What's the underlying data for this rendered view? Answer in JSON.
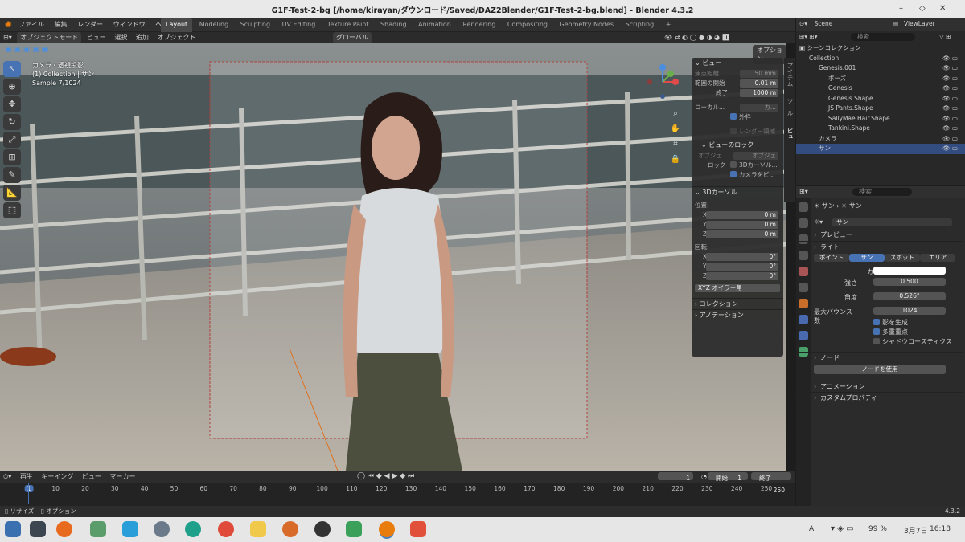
{
  "window": {
    "title": "G1F-Test-2-bg [/home/kirayan/ダウンロード/Saved/DAZ2Blender/G1F-Test-2-bg.blend] - Blender 4.3.2"
  },
  "menu": [
    "ファイル",
    "編集",
    "レンダー",
    "ウィンドウ",
    "ヘルプ"
  ],
  "workspaces": [
    "Layout",
    "Modeling",
    "Sculpting",
    "UV Editing",
    "Texture Paint",
    "Shading",
    "Animation",
    "Rendering",
    "Compositing",
    "Geometry Nodes",
    "Scripting"
  ],
  "scene": {
    "name": "Scene",
    "view_layer": "ViewLayer"
  },
  "viewport_header": {
    "mode": "オブジェクトモード",
    "items": [
      "ビュー",
      "選択",
      "追加",
      "オブジェクト"
    ],
    "orientation": "グローバル",
    "options": "オプション"
  },
  "viewport_info": [
    "カメラ・透視投影",
    "(1) Collection | サン",
    "Sample 7/1024"
  ],
  "npanel": {
    "view_title": "ビュー",
    "focal_label": "焦点距離",
    "focal_value": "50 mm",
    "clip_start_label": "範囲の開始",
    "clip_start_value": "0.01 m",
    "clip_end_label": "終了",
    "clip_end_value": "1000 m",
    "local_label": "ローカル...",
    "local_value": "カ...",
    "outline_label": "外枠",
    "render_region_label": "レンダー領域",
    "lock_title": "ビューのロック",
    "lock_object_label": "オブジェ...",
    "lock_object_value": "オブジェ",
    "lock_label": "ロック",
    "lock_cursor_label": "3Dカーソル...",
    "lock_camera_label": "カメラをビ...",
    "cursor_title": "3Dカーソル",
    "location_label": "位置:",
    "x": "0 m",
    "y": "0 m",
    "z": "0 m",
    "rotation_label": "回転:",
    "rx": "0°",
    "ry": "0°",
    "rz": "0°",
    "rotation_mode": "XYZ オイラー角",
    "collection_title": "コレクション",
    "annotation_title": "アノテーション"
  },
  "side_tabs": [
    "アイテム",
    "ツール",
    "ビュー"
  ],
  "outliner": {
    "search_placeholder": "検索",
    "root": "シーンコレクション",
    "items": [
      {
        "name": "Collection",
        "indent": 1
      },
      {
        "name": "Genesis.001",
        "indent": 2
      },
      {
        "name": "ポーズ",
        "indent": 3
      },
      {
        "name": "Genesis",
        "indent": 3
      },
      {
        "name": "Genesis.Shape",
        "indent": 3
      },
      {
        "name": "JS Pants.Shape",
        "indent": 3
      },
      {
        "name": "SallyMae Hair.Shape",
        "indent": 3
      },
      {
        "name": "Tankini.Shape",
        "indent": 3
      },
      {
        "name": "カメラ",
        "indent": 2
      },
      {
        "name": "サン",
        "indent": 2
      }
    ]
  },
  "properties": {
    "search_placeholder": "検索",
    "breadcrumb_obj": "サン",
    "breadcrumb_data": "サン",
    "datablock": "サン",
    "preview": "プレビュー",
    "light": "ライト",
    "light_types": [
      "ポイント",
      "サン",
      "スポット",
      "エリア"
    ],
    "active_type": "サン",
    "color_label": "カラー",
    "strength_label": "強さ",
    "strength_value": "0.500",
    "angle_label": "角度",
    "angle_value": "0.526°",
    "bounces_label": "最大バウンス数",
    "bounces_value": "1024",
    "cast_shadow": "影を生成",
    "multiple_importance": "多重重点",
    "shadow_caustics": "シャドウコースティクス",
    "nodes": "ノード",
    "use_nodes": "ノードを使用",
    "animation": "アニメーション",
    "custom_props": "カスタムプロパティ"
  },
  "timeline": {
    "menu": [
      "再生",
      "キーイング",
      "ビュー",
      "マーカー"
    ],
    "current_frame": "1",
    "start_label": "開始",
    "start": "1",
    "end_label": "終了",
    "end": "250",
    "frame_marks": [
      "1",
      "10",
      "20",
      "30",
      "40",
      "50",
      "60",
      "70",
      "80",
      "90",
      "100",
      "110",
      "120",
      "130",
      "140",
      "150",
      "160",
      "170",
      "180",
      "190",
      "200",
      "210",
      "220",
      "230",
      "240",
      "250"
    ]
  },
  "status": {
    "left1": "リサイズ",
    "left2": "オプション",
    "version": "4.3.2"
  },
  "taskbar": {
    "input": "A",
    "battery": "99 %",
    "date": "3月7日",
    "time": "16:18"
  }
}
